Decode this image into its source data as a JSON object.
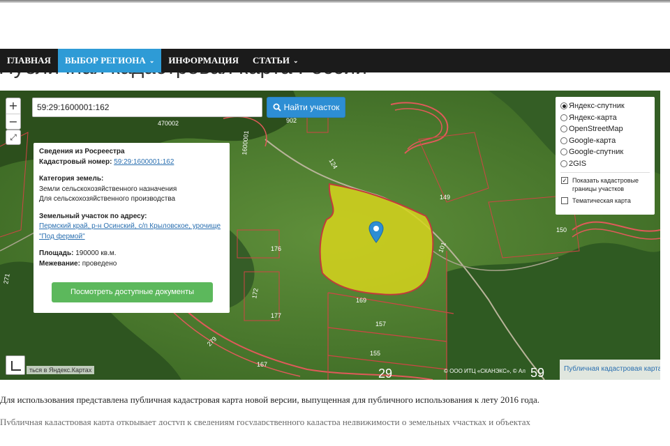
{
  "page": {
    "title": "Публичная кадастровая карта России"
  },
  "nav": {
    "items": [
      {
        "label": "ГЛАВНАЯ"
      },
      {
        "label": "ВЫБОР РЕГИОНА",
        "caret": "⌄"
      },
      {
        "label": "ИНФОРМАЦИЯ"
      },
      {
        "label": "СТАТЬИ",
        "caret": "⌄"
      }
    ]
  },
  "map": {
    "zoom_in": "+",
    "zoom_out": "−",
    "fullscreen": "⤢",
    "search_value": "59:29:1600001:162",
    "find_button": "Найти участок",
    "find_icon": "search-icon",
    "info": {
      "heading": "Сведения из Росреестра",
      "cadastral_label": "Кадастровый номер:",
      "cadastral_value": "59:29:1600001:162",
      "category_label": "Категория земель:",
      "category_value1": "Земли сельскохозяйственного назначения",
      "category_value2": "Для сельскохозяйственного производства",
      "address_label": "Земельный участок по адресу:",
      "address_value": "Пермский край, р-н Осинский, с/п Крыловское, урочище \"Под фермой\"",
      "area_label": "Площадь:",
      "area_value": "190000 кв.м.",
      "survey_label": "Межевание:",
      "survey_value": "проведено",
      "docs_button": "Посмотреть доступные документы"
    },
    "layers": {
      "options": [
        {
          "label": "Яндекс-спутник",
          "selected": true
        },
        {
          "label": "Яндекс-карта",
          "selected": false
        },
        {
          "label": "OpenStreetMap",
          "selected": false
        },
        {
          "label": "Google-карта",
          "selected": false
        },
        {
          "label": "Google-спутник",
          "selected": false
        },
        {
          "label": "2GIS",
          "selected": false
        }
      ],
      "show_boundaries": "Показать кадастровые границы участков",
      "show_boundaries_checked": true,
      "thematic": "Тематическая карта",
      "thematic_checked": false
    },
    "plot_labels": [
      "149",
      "150",
      "101",
      "169",
      "157",
      "155",
      "167",
      "177",
      "176",
      "172",
      "124",
      "902",
      "1600001",
      "470002",
      "279",
      "271"
    ],
    "big_labels": [
      "29",
      "59"
    ],
    "yandex_credit": "ться в Яндекс.Картах",
    "copyright": "© ООО ИТЦ «СКАНЭКС», © Ал",
    "pkk_link": "Публичная кадастровая карта",
    "colors": {
      "parcel_fill": "#d6d41c",
      "boundary": "#e05a5a",
      "accent": "#2e9bd6",
      "button_green": "#5cb85c"
    }
  },
  "content": {
    "paragraph": "Для использования представлена публичная кадастровая карта новой версии, выпущенная для публичного использования к лету 2016 года.",
    "paragraph2": "Публичная кадастровая карта открывает доступ к сведениям государственного кадастра недвижимости о земельных участках и объектах"
  }
}
